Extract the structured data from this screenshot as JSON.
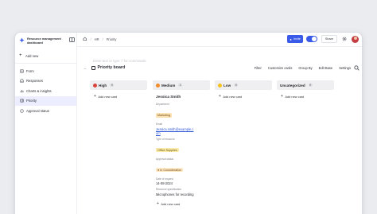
{
  "app": {
    "title": "Resource management dashboard"
  },
  "sidebar": {
    "new_label": "Add new",
    "items": [
      {
        "label": "Form",
        "icon": "form-icon",
        "active": false
      },
      {
        "label": "Responses",
        "icon": "inbox-icon",
        "active": false
      },
      {
        "label": "Charts & insights",
        "icon": "chart-icon",
        "active": false
      },
      {
        "label": "Priority",
        "icon": "board-icon",
        "active": true
      },
      {
        "label": "Approval status",
        "icon": "check-circle-icon",
        "active": false
      }
    ]
  },
  "breadcrumb": {
    "home_icon": "home-icon",
    "items": [
      "HR",
      "Priority"
    ]
  },
  "topbar": {
    "invite_label": "Invite",
    "share_label": "Share",
    "toggle_on": true
  },
  "board": {
    "command_hint": "Enter text or type '/' for commands",
    "title": "Priority board",
    "toolbar": [
      "Filter",
      "Customize cards",
      "Group By",
      "Edit Base",
      "Settings"
    ],
    "add_card_label": "Add new card",
    "columns": [
      {
        "label": "High",
        "count": "0",
        "dot_color": "#d9433b"
      },
      {
        "label": "Medium",
        "count": "1",
        "dot_color": "#f08c2a"
      },
      {
        "label": "Low",
        "count": "0",
        "dot_color": "#f5c21d"
      },
      {
        "label": "Uncategorized",
        "count": "0",
        "dot_color": ""
      }
    ],
    "card": {
      "title": "Jessica Smith",
      "department_label": "Department",
      "department": "Marketing",
      "email_label": "Email",
      "email": "Jessica.smith@example.com",
      "resource_type_label": "Type of resource",
      "resource_type": "Office Supplies",
      "approval_label": "Approval status",
      "approval": "In Consideration",
      "date_label": "Date of request",
      "date": "14-08-2024",
      "spec_label": "Resource specification",
      "spec": "Microphones for recording"
    }
  },
  "colors": {
    "accent": "#3a5ae8",
    "active_nav_bg": "#ecedff",
    "link": "#2d56d6"
  }
}
